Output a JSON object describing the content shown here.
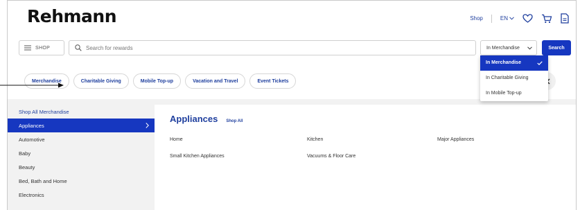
{
  "header": {
    "brand": "Rehmann",
    "shop_link": "Shop",
    "language": "EN",
    "icons": [
      "heart-icon",
      "cart-icon",
      "document-icon"
    ]
  },
  "search": {
    "menu_label": "SHOP",
    "placeholder": "Search for rewards",
    "scope_value": "In Merchandise",
    "button_label": "Search"
  },
  "scope_dropdown": {
    "options": [
      {
        "label": "In Merchandise",
        "selected": true
      },
      {
        "label": "In Charitable Giving",
        "selected": false
      },
      {
        "label": "In Mobile Top-up",
        "selected": false
      }
    ]
  },
  "category_pills": [
    "Merchandise",
    "Charitable Giving",
    "Mobile Top-up",
    "Vacation and Travel",
    "Event Tickets"
  ],
  "sidebar": {
    "top_link": "Shop All Merchandise",
    "items": [
      "Appliances",
      "Automotive",
      "Baby",
      "Beauty",
      "Bed, Bath and Home",
      "Electronics"
    ],
    "active_index": 0
  },
  "main": {
    "title": "Appliances",
    "shop_all": "Shop All",
    "subcategories": [
      "Home",
      "Kitchen",
      "Major Appliances",
      "Small Kitchen Appliances",
      "Vacuums & Floor Care"
    ]
  },
  "colors": {
    "accent": "#1637c0",
    "link": "#1f3f9e",
    "panel": "#f2f2f2"
  }
}
